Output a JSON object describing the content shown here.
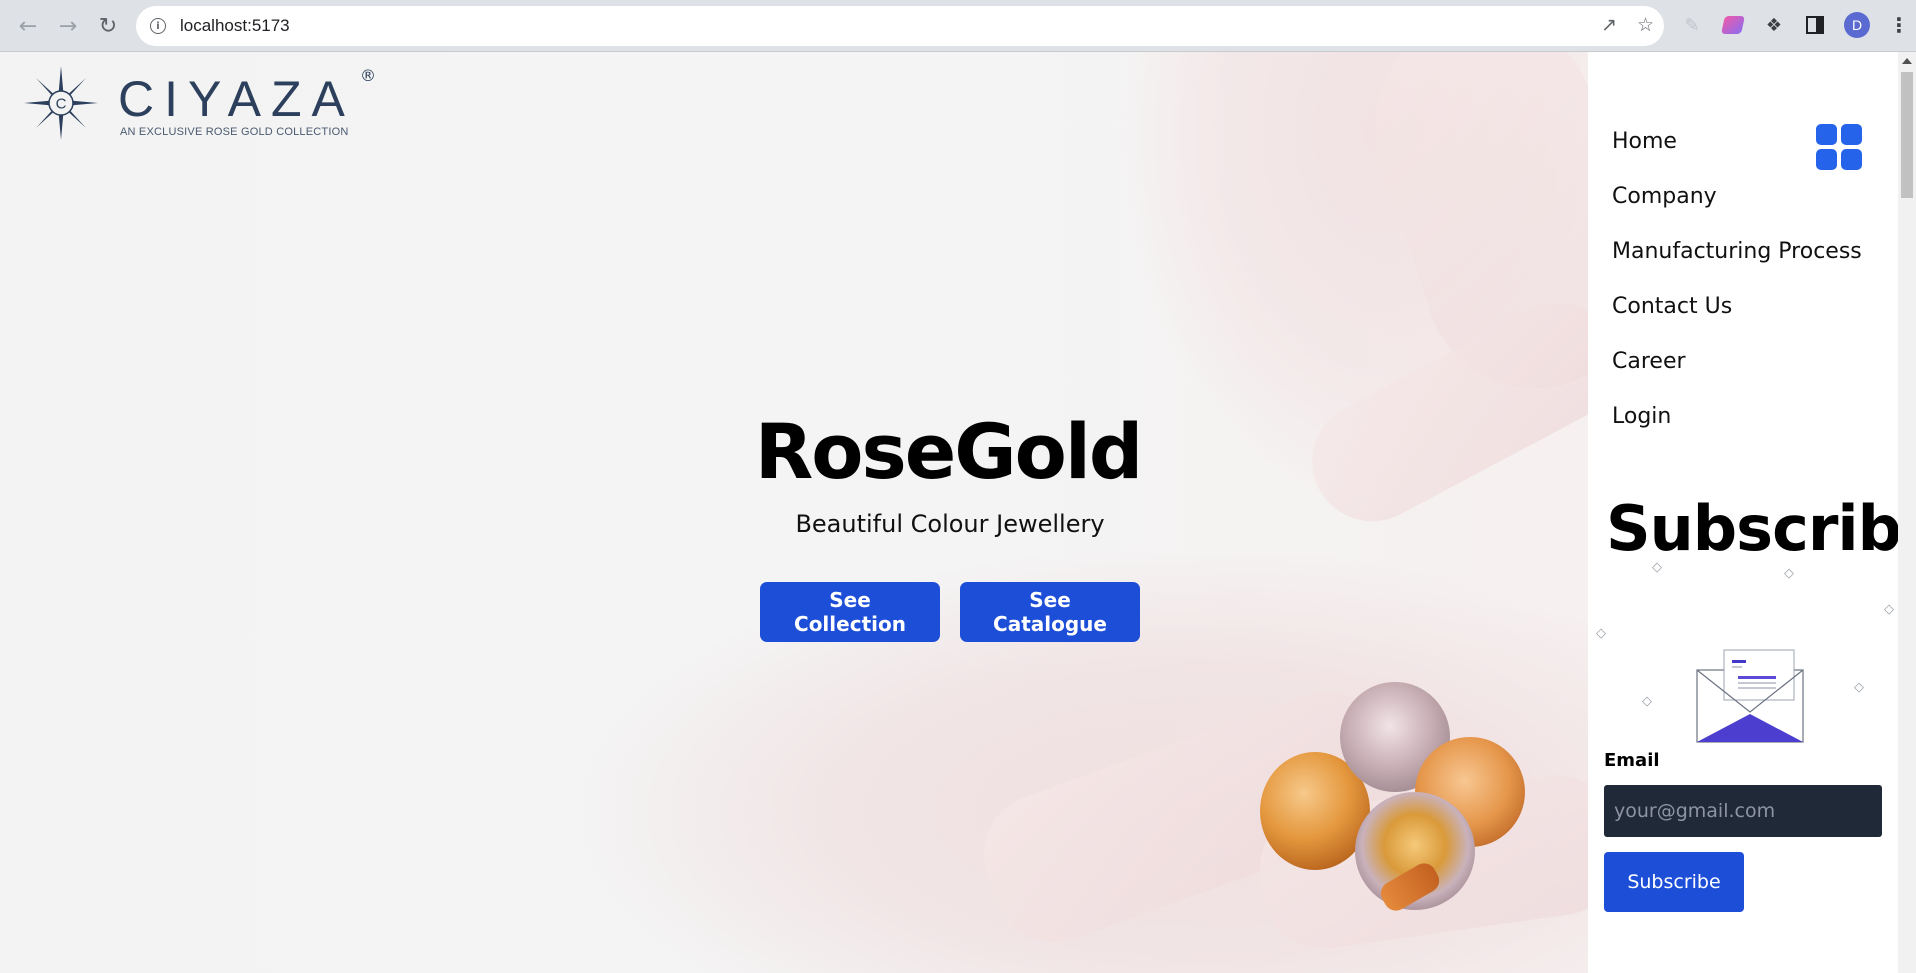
{
  "browser": {
    "url": "localhost:5173",
    "profile_initial": "D",
    "icons": {
      "back": "arrow-left-icon",
      "forward": "arrow-right-icon",
      "reload": "reload-icon",
      "info": "info-icon",
      "share": "share-icon",
      "bookmark": "star-icon",
      "extensions": "puzzle-icon",
      "side_panel": "side-panel-icon",
      "menu": "kebab-menu-icon"
    }
  },
  "logo": {
    "wordmark": "CIYAZA",
    "registered": "®",
    "tagline": "AN EXCLUSIVE ROSE GOLD COLLECTION"
  },
  "hero": {
    "title": "RoseGold",
    "subtitle": "Beautiful Colour Jewellery",
    "buttons": {
      "collection": "See Collection",
      "catalogue": "See Catalogue"
    }
  },
  "sidebar": {
    "menu": [
      {
        "label": "Home"
      },
      {
        "label": "Company"
      },
      {
        "label": "Manufacturing Process"
      },
      {
        "label": "Contact Us"
      },
      {
        "label": "Career"
      },
      {
        "label": "Login"
      }
    ],
    "subscribe": {
      "title": "Subscribe",
      "email_label": "Email",
      "email_placeholder": "your@gmail.com",
      "button": "Subscribe"
    }
  },
  "colors": {
    "accent": "#1d4ed8",
    "grid_icon": "#2563eb",
    "logo": "#2c3f5c",
    "input_bg": "#1f2937"
  }
}
